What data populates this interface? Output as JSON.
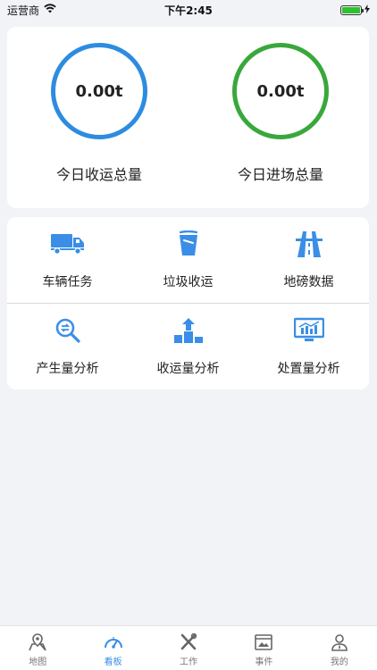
{
  "status_bar": {
    "carrier": "运营商",
    "time": "下午2:45"
  },
  "totals": {
    "left": {
      "value": "0.00t",
      "label": "今日收运总量",
      "color": "#2d8ce0"
    },
    "right": {
      "value": "0.00t",
      "label": "今日进场总量",
      "color": "#39a83c"
    }
  },
  "grid": {
    "items": [
      {
        "label": "车辆任务",
        "icon": "truck-icon"
      },
      {
        "label": "垃圾收运",
        "icon": "trash-bin-icon"
      },
      {
        "label": "地磅数据",
        "icon": "highway-icon"
      },
      {
        "label": "产生量分析",
        "icon": "search-analysis-icon"
      },
      {
        "label": "收运量分析",
        "icon": "upload-podium-icon"
      },
      {
        "label": "处置量分析",
        "icon": "monitor-chart-icon"
      }
    ]
  },
  "tabs": [
    {
      "label": "地图",
      "icon": "map-pin-icon",
      "active": false
    },
    {
      "label": "看板",
      "icon": "dashboard-gauge-icon",
      "active": true
    },
    {
      "label": "工作",
      "icon": "tools-icon",
      "active": false
    },
    {
      "label": "事件",
      "icon": "event-window-icon",
      "active": false
    },
    {
      "label": "我的",
      "icon": "user-icon",
      "active": false
    }
  ],
  "colors": {
    "accent": "#3a8ee6",
    "icon_blue": "#3a8ee6",
    "inactive": "#777777"
  }
}
